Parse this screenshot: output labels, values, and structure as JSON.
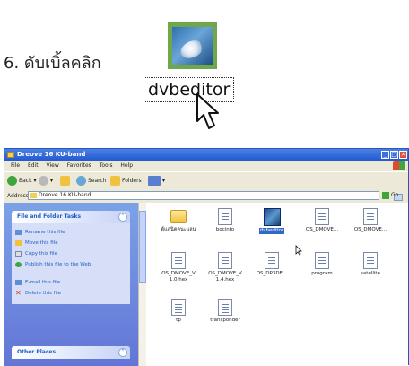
{
  "caption": {
    "step": "6. ดับเบิ้ลคลิก"
  },
  "big_icon": {
    "label": "dvbeditor"
  },
  "window": {
    "title": "Dreove 16 KU-band",
    "menu": [
      "File",
      "Edit",
      "View",
      "Favorites",
      "Tools",
      "Help"
    ],
    "toolbar": {
      "back": "Back",
      "search": "Search",
      "folders": "Folders"
    },
    "address": {
      "label": "Address",
      "value": "Dreove 16 KU-band",
      "go": "Go"
    },
    "tasks_panel": {
      "title": "File and Folder Tasks",
      "items": [
        "Rename this file",
        "Move this file",
        "Copy this file",
        "Publish this file to the Web",
        "E-mail this file",
        "Delete this file"
      ]
    },
    "other_panel": {
      "title": "Other Places"
    },
    "files": [
      {
        "label": "ตุ้แลนิตคนะแลน",
        "type": "folder"
      },
      {
        "label": "bocinfo",
        "type": "doc"
      },
      {
        "label": "dvbeditor",
        "type": "selected"
      },
      {
        "label": "OS_DMOVE...",
        "type": "doc"
      },
      {
        "label": "OS_DMOVE...",
        "type": "doc"
      },
      {
        "label": "OS_DMOVE_V 1.0.hex",
        "type": "doc"
      },
      {
        "label": "OS_DMOVE_V 1.4.hex",
        "type": "doc"
      },
      {
        "label": "OS_DP3DE...",
        "type": "doc"
      },
      {
        "label": "program",
        "type": "doc"
      },
      {
        "label": "satellite",
        "type": "doc"
      },
      {
        "label": "tp",
        "type": "doc"
      },
      {
        "label": "transponder",
        "type": "doc"
      }
    ]
  },
  "colors": {
    "title_blue": "#2458cf",
    "task_link": "#215dc6",
    "selection": "#316ac5"
  }
}
